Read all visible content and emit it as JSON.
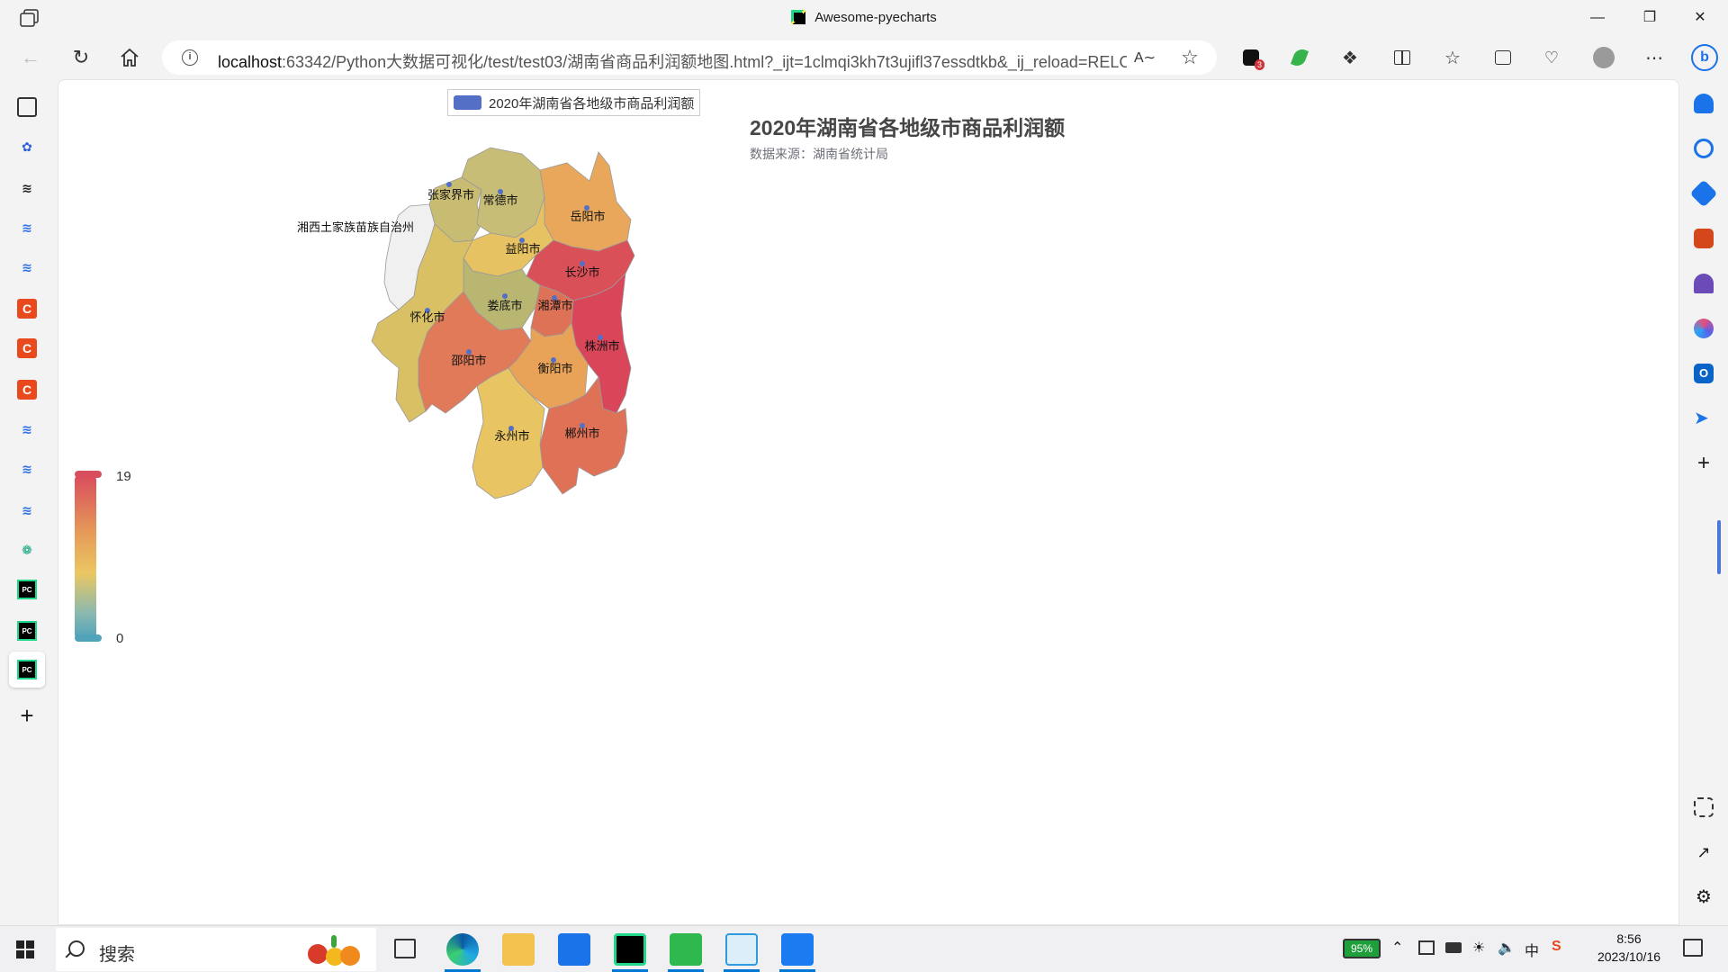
{
  "window": {
    "title": "Awesome-pyecharts"
  },
  "toolbar": {
    "url_host": "localhost",
    "url_rest": ":63342/Python大数据可视化/test/test03/湖南省商品利润额地图.html?_ijt=1clmqi3kh7t3ujifl37essdtkb&_ij_reload=RELO...",
    "extension_badge": "3"
  },
  "chart": {
    "legend": "2020年湖南省各地级市商品利润额",
    "title": "2020年湖南省各地级市商品利润额",
    "subtitle": "数据来源：湖南省统计局",
    "visualmap": {
      "max_label": "19",
      "min_label": "0"
    }
  },
  "chart_data": {
    "type": "map",
    "title": "2020年湖南省各地级市商品利润额",
    "subtitle": "数据来源：湖南省统计局",
    "series_name": "2020年湖南省各地级市商品利润额",
    "visualmap_range": [
      0,
      19
    ],
    "regions": [
      {
        "name": "张家界市",
        "value": 8,
        "color": "#c8bc73"
      },
      {
        "name": "常德市",
        "value": 8,
        "color": "#c8bd77"
      },
      {
        "name": "岳阳市",
        "value": 14,
        "color": "#e8a75b"
      },
      {
        "name": "湘西土家族苗族自治州",
        "value": 0,
        "color": "#f0f0f0"
      },
      {
        "name": "益阳市",
        "value": 11,
        "color": "#e7c262"
      },
      {
        "name": "长沙市",
        "value": 19,
        "color": "#da5059"
      },
      {
        "name": "娄底市",
        "value": 6,
        "color": "#b8b671"
      },
      {
        "name": "湘潭市",
        "value": 16,
        "color": "#de7256"
      },
      {
        "name": "怀化市",
        "value": 10,
        "color": "#d9c065"
      },
      {
        "name": "株洲市",
        "value": 19,
        "color": "#d9465a"
      },
      {
        "name": "邵阳市",
        "value": 16,
        "color": "#e07a58"
      },
      {
        "name": "衡阳市",
        "value": 14,
        "color": "#e9a358"
      },
      {
        "name": "永州市",
        "value": 11,
        "color": "#e9c462"
      },
      {
        "name": "郴州市",
        "value": 16,
        "color": "#df7157"
      }
    ]
  },
  "taskbar": {
    "search_placeholder": "搜索",
    "battery": "95%",
    "time": "8:56",
    "date": "2023/10/16"
  }
}
